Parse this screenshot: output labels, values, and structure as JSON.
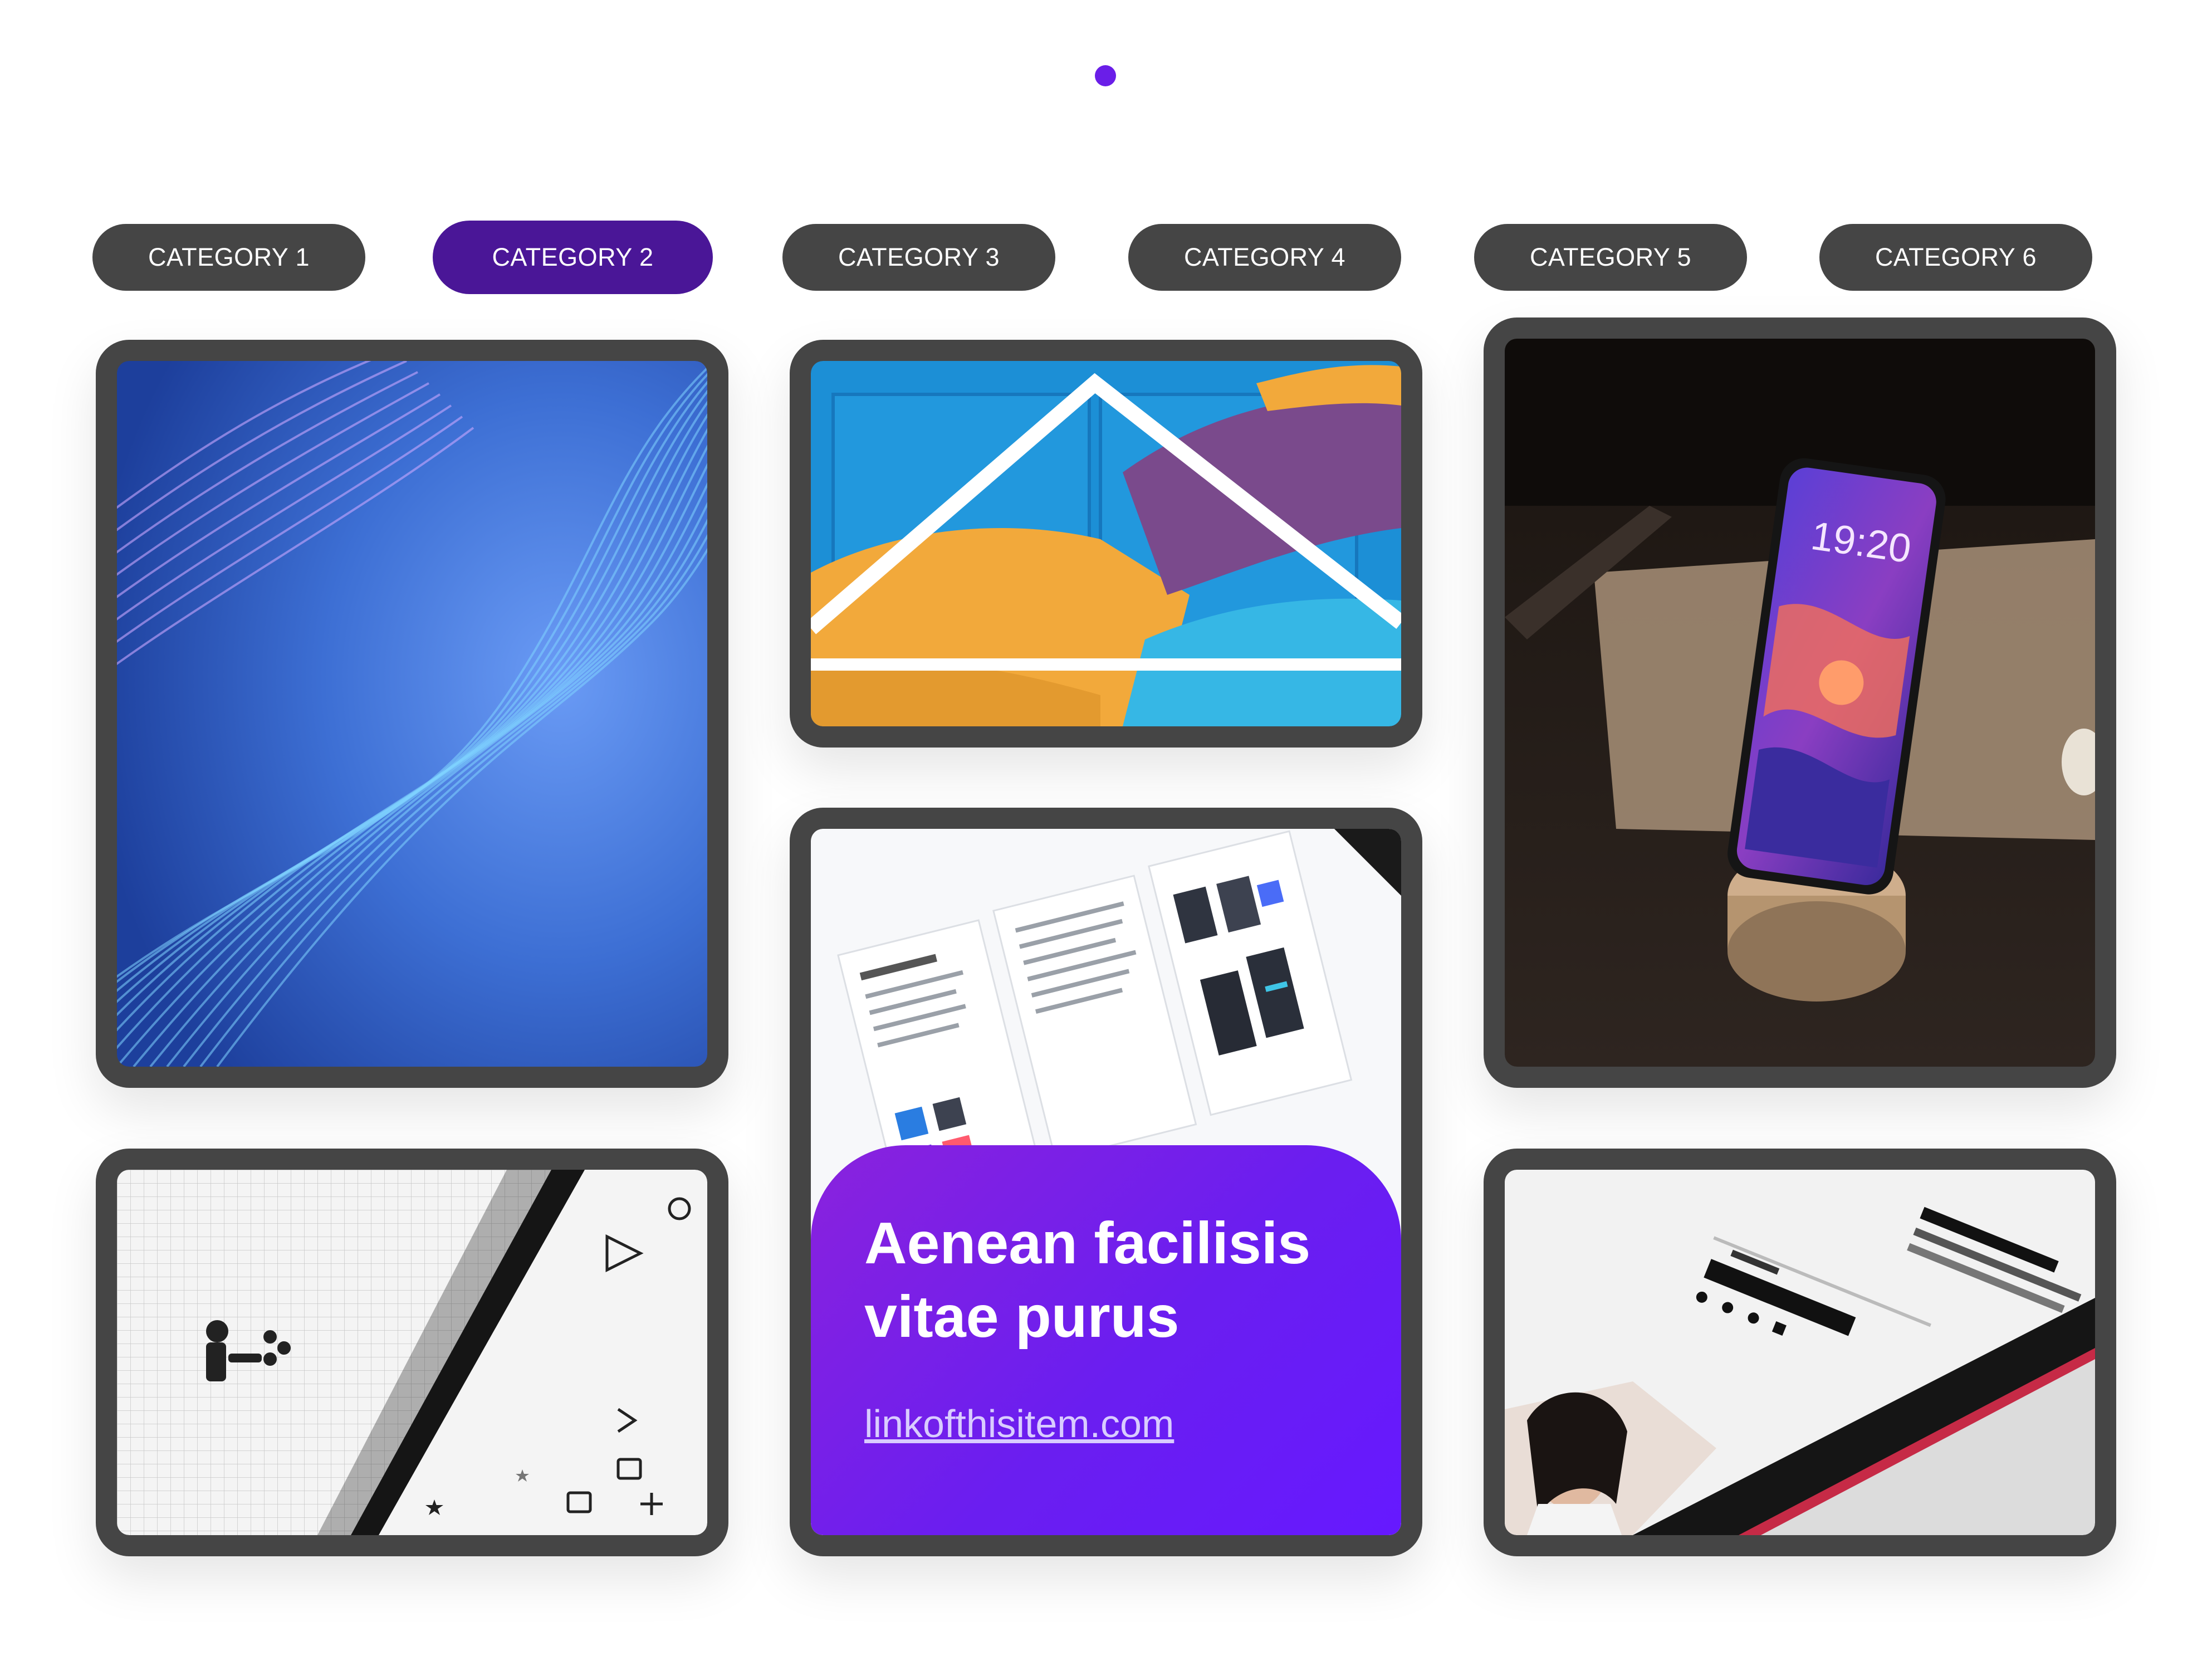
{
  "tabs": [
    {
      "label": "CATEGORY 1",
      "active": false
    },
    {
      "label": "CATEGORY 2",
      "active": true
    },
    {
      "label": "CATEGORY 3",
      "active": false
    },
    {
      "label": "CATEGORY 4",
      "active": false
    },
    {
      "label": "CATEGORY 5",
      "active": false
    },
    {
      "label": "CATEGORY 6",
      "active": false
    }
  ],
  "colors": {
    "accent": "#6a1ee8",
    "active_tab": "#4a1697",
    "tab": "#454545",
    "card_frame": "#454545"
  },
  "gallery": {
    "items": [
      {
        "image": "blue-wave-lines"
      },
      {
        "image": "colorful-mural-wall"
      },
      {
        "image": "smartphone-on-stand"
      },
      {
        "image": "tablet-icon-sketches"
      },
      {
        "image": "ui-design-screen",
        "overlay": {
          "title": "Aenean facilisis vitae purus",
          "link": "linkofthisitem.com"
        }
      },
      {
        "image": "tablet-blog-page"
      }
    ]
  }
}
